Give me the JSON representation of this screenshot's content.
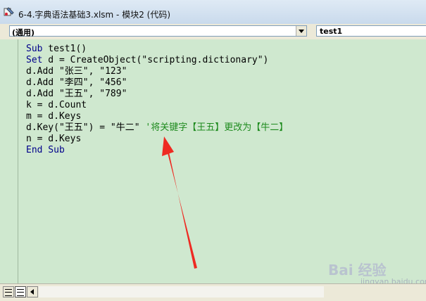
{
  "window": {
    "title": "6-4.字典语法基础3.xlsm - 模块2 (代码)",
    "icon": "vba-module-icon"
  },
  "object_combo": {
    "value": "(通用)"
  },
  "procedure_combo": {
    "value": "test1"
  },
  "code": {
    "lines": [
      {
        "kw": "Sub",
        "text": " test1()",
        "comment": ""
      },
      {
        "kw": "Set",
        "text": " d = CreateObject(\"scripting.dictionary\")",
        "comment": ""
      },
      {
        "kw": "",
        "text": "d.Add \"张三\", \"123\"",
        "comment": ""
      },
      {
        "kw": "",
        "text": "d.Add \"李四\", \"456\"",
        "comment": ""
      },
      {
        "kw": "",
        "text": "d.Add \"王五\", \"789\"",
        "comment": ""
      },
      {
        "kw": "",
        "text": "k = d.Count",
        "comment": ""
      },
      {
        "kw": "",
        "text": "m = d.Keys",
        "comment": ""
      },
      {
        "kw": "",
        "text": "d.Key(\"王五\") = \"牛二\" ",
        "comment": "'将关键字【王五】更改为【牛二】"
      },
      {
        "kw": "",
        "text": "n = d.Keys",
        "comment": ""
      },
      {
        "kw": "End Sub",
        "text": "",
        "comment": ""
      }
    ],
    "colors": {
      "keyword": "#00008b",
      "comment": "#1d8a1d",
      "background": "#cfe8cf"
    }
  },
  "annotation": {
    "color": "#ee2a22"
  },
  "watermark": {
    "text": "Bai 经验",
    "sub": "jingyan.baidu.com"
  }
}
